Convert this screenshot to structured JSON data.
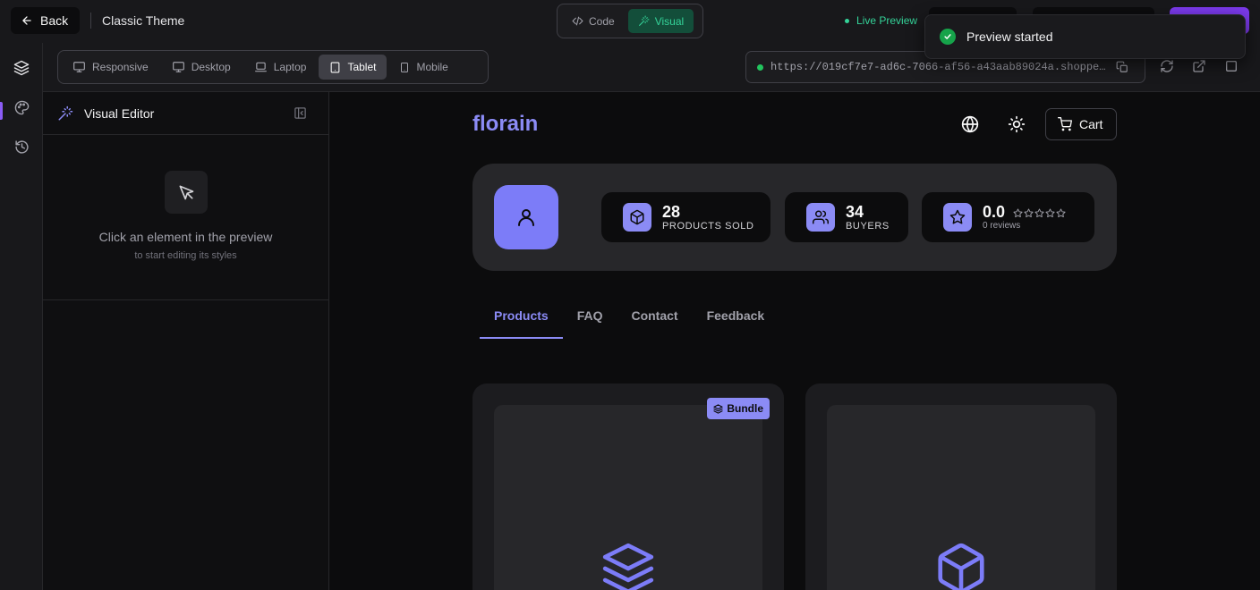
{
  "topbar": {
    "back_label": "Back",
    "theme_name": "Classic Theme",
    "modes": [
      {
        "label": "Code"
      },
      {
        "label": "Visual"
      }
    ],
    "live_preview_label": "Live Preview"
  },
  "toast": {
    "message": "Preview started"
  },
  "rail": {
    "items": [
      "layers-icon",
      "palette-icon",
      "history-icon"
    ]
  },
  "devices": [
    {
      "label": "Responsive",
      "icon": "monitor-icon"
    },
    {
      "label": "Desktop",
      "icon": "monitor-icon"
    },
    {
      "label": "Laptop",
      "icon": "laptop-icon"
    },
    {
      "label": "Tablet",
      "icon": "tablet-icon"
    },
    {
      "label": "Mobile",
      "icon": "smartphone-icon"
    }
  ],
  "active_device": "Tablet",
  "url": {
    "text": "https://019cf7e7-ad6c-7066-af56-a43aab89024a.shoppe…"
  },
  "panel": {
    "title": "Visual Editor",
    "empty_title": "Click an element in the preview",
    "empty_sub": "to start editing its styles"
  },
  "store": {
    "logo": "florain",
    "cart_label": "Cart",
    "stats": [
      {
        "value": "28",
        "label": "PRODUCTS SOLD"
      },
      {
        "value": "34",
        "label": "BUYERS"
      },
      {
        "value": "0.0",
        "label": "0 reviews"
      }
    ],
    "rating_stars_filled": 0,
    "rating_stars_total": 5,
    "tabs": [
      "Products",
      "FAQ",
      "Contact",
      "Feedback"
    ],
    "active_tab": "Products",
    "products": [
      {
        "badge": "Bundle",
        "icon": "layers-icon"
      },
      {
        "badge": "",
        "icon": "package-icon"
      }
    ]
  },
  "colors": {
    "accent": "#8b8bf5",
    "live": "#34d399",
    "primary_button": "#7c3aed",
    "background": "#0c0c0d"
  }
}
